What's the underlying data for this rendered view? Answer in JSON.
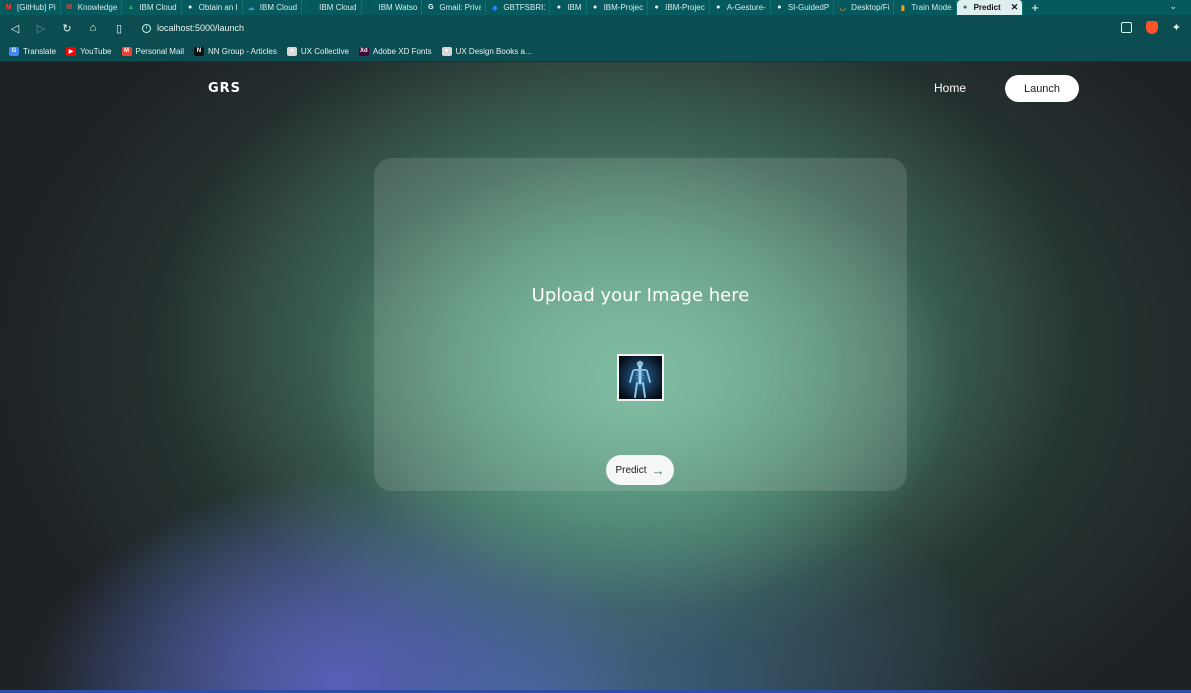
{
  "browser": {
    "tabs": [
      {
        "label": "[GitHub] Pi",
        "icon": "gmail-icon",
        "color": "#ea4335",
        "glyph": "M"
      },
      {
        "label": "Knowledge",
        "icon": "gmail-icon",
        "color": "#ea4335",
        "glyph": "M"
      },
      {
        "label": "IBM Cloud",
        "icon": "drive-icon",
        "color": "#34a853",
        "glyph": "▲"
      },
      {
        "label": "Obtain an I",
        "icon": "globe-icon",
        "color": "#ffffff",
        "glyph": "●"
      },
      {
        "label": "IBM Cloud",
        "icon": "ibm-cloud-icon",
        "color": "#4d8fd1",
        "glyph": "☁"
      },
      {
        "label": "IBM Cloud",
        "icon": "ibm-cloud-icon",
        "color": "#0d2b3a",
        "glyph": "◌"
      },
      {
        "label": "IBM Watso",
        "icon": "watson-icon",
        "color": "#0d2b3a",
        "glyph": "◌"
      },
      {
        "label": "Gmail: Priva",
        "icon": "google-icon",
        "color": "#ffffff",
        "glyph": "G"
      },
      {
        "label": "GBTFSBRI1",
        "icon": "jira-icon",
        "color": "#2684ff",
        "glyph": "◆"
      },
      {
        "label": "IBM",
        "icon": "globe-icon",
        "color": "#ffffff",
        "glyph": "●"
      },
      {
        "label": "IBM-Projec",
        "icon": "github-icon",
        "color": "#ffffff",
        "glyph": "●"
      },
      {
        "label": "IBM-Projec",
        "icon": "github-icon",
        "color": "#ffffff",
        "glyph": "●"
      },
      {
        "label": "A-Gesture-",
        "icon": "github-icon",
        "color": "#ffffff",
        "glyph": "●"
      },
      {
        "label": "SI-GuidedP",
        "icon": "github-icon",
        "color": "#ffffff",
        "glyph": "●"
      },
      {
        "label": "Desktop/Fi",
        "icon": "jupyter-icon",
        "color": "#f37626",
        "glyph": "◡"
      },
      {
        "label": "Train Mode",
        "icon": "notebook-icon",
        "color": "#f6a21b",
        "glyph": "▮"
      },
      {
        "label": "Predict",
        "icon": "globe-icon",
        "color": "#555555",
        "glyph": "●",
        "active": true
      }
    ],
    "new_tab": "+",
    "tab_list": "⌄",
    "address": "localhost:5000/launch",
    "bookmarks": [
      {
        "label": "Translate",
        "icon": "translate-icon",
        "color": "#4285f4",
        "glyph": "G"
      },
      {
        "label": "YouTube",
        "icon": "youtube-icon",
        "color": "#ff0000",
        "glyph": "▶"
      },
      {
        "label": "Personal Mail",
        "icon": "gmail-icon",
        "color": "#ea4335",
        "glyph": "M"
      },
      {
        "label": "NN Group - Articles",
        "icon": "nngroup-icon",
        "color": "#111111",
        "glyph": "N"
      },
      {
        "label": "UX Collective",
        "icon": "globe-icon",
        "color": "#d8d8d8",
        "glyph": "●"
      },
      {
        "label": "Adobe XD Fonts",
        "icon": "adobe-xd-icon",
        "color": "#470137",
        "glyph": "Xd"
      },
      {
        "label": "UX Design Books a...",
        "icon": "globe-icon",
        "color": "#d8d8d8",
        "glyph": "●"
      }
    ]
  },
  "site": {
    "logo": "GRS",
    "nav": {
      "home": "Home",
      "launch": "Launch"
    },
    "card": {
      "title": "Upload your Image here",
      "predict_label": "Predict",
      "predict_arrow": "→"
    }
  },
  "colors": {
    "tab_bar": "#065a5e",
    "toolbar": "#0b4d51",
    "page_bg": "#1e2225",
    "accent_green": "#70b898",
    "accent_blue": "#5860ba"
  }
}
